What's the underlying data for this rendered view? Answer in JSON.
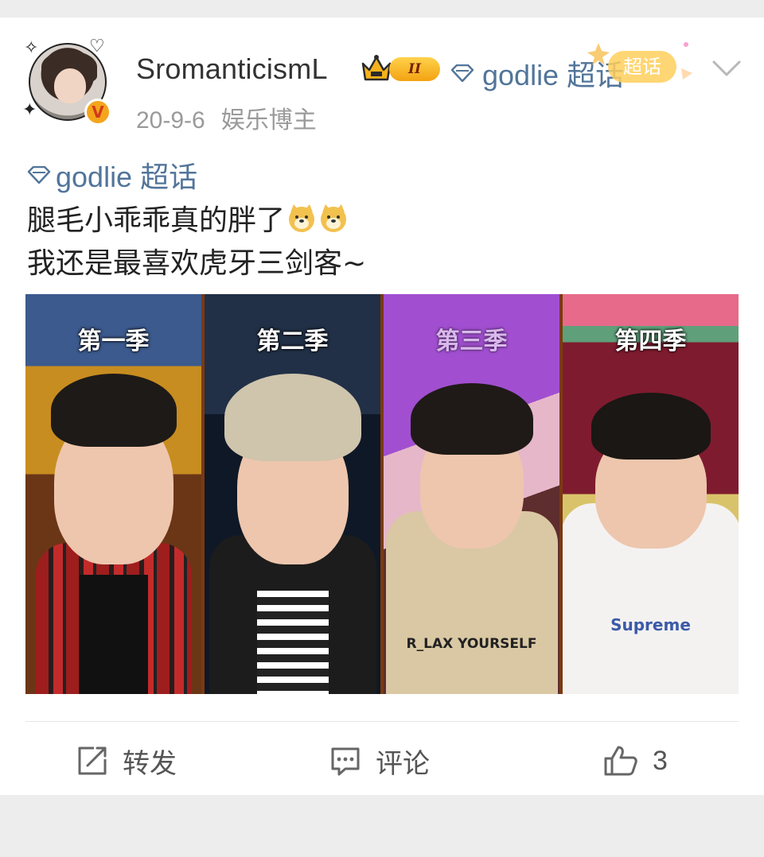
{
  "header": {
    "username": "SromanticismL",
    "level": "II",
    "topic": "godlie 超话",
    "topic_badge": "超话",
    "date": "20-9-6",
    "role": "娱乐博主"
  },
  "post": {
    "topic": "godlie 超话",
    "line1": "腿毛小乖乖真的胖了",
    "line2": "我还是最喜欢虎牙三剑客~",
    "emojis": [
      "doge-icon",
      "doge-icon"
    ],
    "image": {
      "panels": [
        {
          "label": "第一季"
        },
        {
          "label": "第二季"
        },
        {
          "label": "第三季"
        },
        {
          "label": "第四季"
        }
      ],
      "shirt_text_3": "R_LAX YOURSELF",
      "shirt_text_4": "Supreme"
    }
  },
  "actions": {
    "repost": "转发",
    "comment": "评论",
    "like_count": "3"
  },
  "colors": {
    "link": "#52759a",
    "meta": "#9a9a9a",
    "background": "#ededed"
  }
}
